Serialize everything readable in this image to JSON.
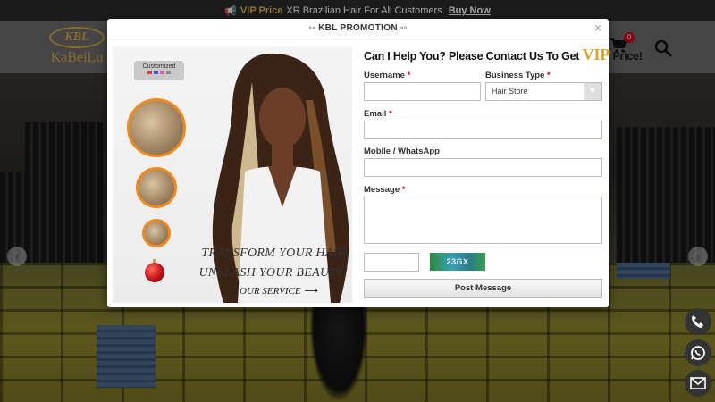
{
  "topbar": {
    "icon": "megaphone-icon",
    "vip_label": "VIP Price",
    "message": "XR Brazilian Hair For All Customers.",
    "cta": "Buy Now"
  },
  "header": {
    "logo_mark": "KBL",
    "logo_text": "KaBeiLu",
    "cart_count": "0",
    "icons": [
      "cart-icon",
      "search-icon"
    ]
  },
  "modal": {
    "title": "◦◦ KBL PROMOTION ◦◦",
    "close": "×",
    "promo": {
      "badge": "Customized",
      "tagline_1": "TRANSFORM YOUR HAIR",
      "tagline_2": "UNLEASH YOUR BEAUTY!",
      "service": "OUR SERVICE ⟶"
    },
    "form": {
      "heading_pre": "Can I Help You? Please Contact Us To Get ",
      "heading_vip": "VIP",
      "heading_post": " Price!",
      "username_label": "Username",
      "business_label": "Business Type",
      "business_value": "Hair Store",
      "email_label": "Email",
      "mobile_label": "Mobile / WhatsApp",
      "message_label": "Message",
      "required_mark": "*",
      "captcha_text": "23GX",
      "submit_label": "Post Message"
    }
  },
  "floating": [
    "phone-icon",
    "whatsapp-icon",
    "mail-icon"
  ],
  "colors": {
    "accent_gold": "#d9a323",
    "required_red": "#d0021b",
    "topbar_bg": "#2b2b2b"
  }
}
